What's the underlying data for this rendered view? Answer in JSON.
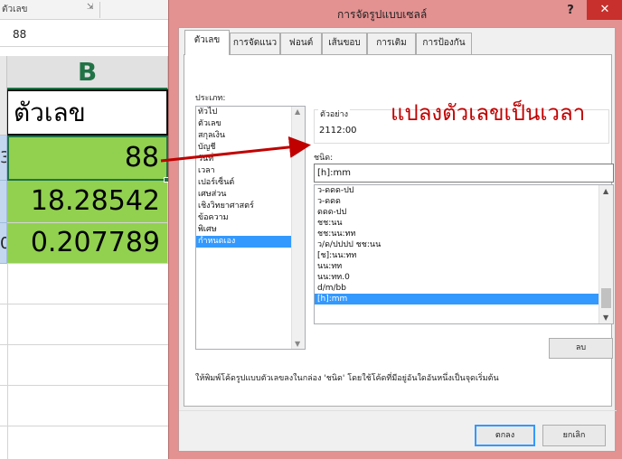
{
  "excel": {
    "ribbon_group_label": "ตัวเลข",
    "launcher_icon": "dialog-launcher-icon",
    "formula_value": "88",
    "column_header": "B",
    "rows": [
      {
        "num": "",
        "value": "ตัวเลข"
      },
      {
        "num": "3",
        "value": "88"
      },
      {
        "num": "",
        "value": "18.28542"
      },
      {
        "num": "0",
        "value": "0.207789"
      }
    ],
    "accent_color": "#217346",
    "cell_fill_color": "#92d050"
  },
  "dialog": {
    "title": "การจัดรูปแบบเซลล์",
    "help_label": "?",
    "close_label": "✕",
    "tabs": [
      "ตัวเลข",
      "การจัดแนว",
      "ฟอนต์",
      "เส้นขอบ",
      "การเติม",
      "การป้องกัน"
    ],
    "active_tab": 0,
    "category_label": "ประเภท:",
    "categories": [
      "ทั่วไป",
      "ตัวเลข",
      "สกุลเงิน",
      "บัญชี",
      "วันที่",
      "เวลา",
      "เปอร์เซ็นต์",
      "เศษส่วน",
      "เชิงวิทยาศาสตร์",
      "ข้อความ",
      "พิเศษ",
      "กำหนดเอง"
    ],
    "selected_category": 11,
    "sample_label": "ตัวอย่าง",
    "sample_value": "2112:00",
    "overlay_text": "แปลงตัวเลขเป็นเวลา",
    "type_label": "ชนิด:",
    "type_value": "[h]:mm",
    "format_codes": [
      "ว-ดดด-ปป",
      "ว-ดดด",
      "ดดด-ปป",
      "ชช:นน",
      "ชช:นน:ทท",
      "ว/ด/ปปปป ชช:นน",
      "[ช]:นน:ทท",
      "นน:ทท",
      "นน:ทท.0",
      "d/m/bb",
      "[h]:mm"
    ],
    "selected_format": 10,
    "delete_label": "ลบ",
    "hint": "ให้พิมพ์โค้ดรูปแบบตัวเลขลงในกล่อง 'ชนิด' โดยใช้โค้ดที่มีอยู่อันใดอันหนึ่งเป็นจุดเริ่มต้น",
    "ok_label": "ตกลง",
    "cancel_label": "ยกเลิก",
    "title_bar_color": "#e39191",
    "close_color": "#c7302c",
    "selection_color": "#3399ff",
    "annotation_color": "#c00000"
  }
}
